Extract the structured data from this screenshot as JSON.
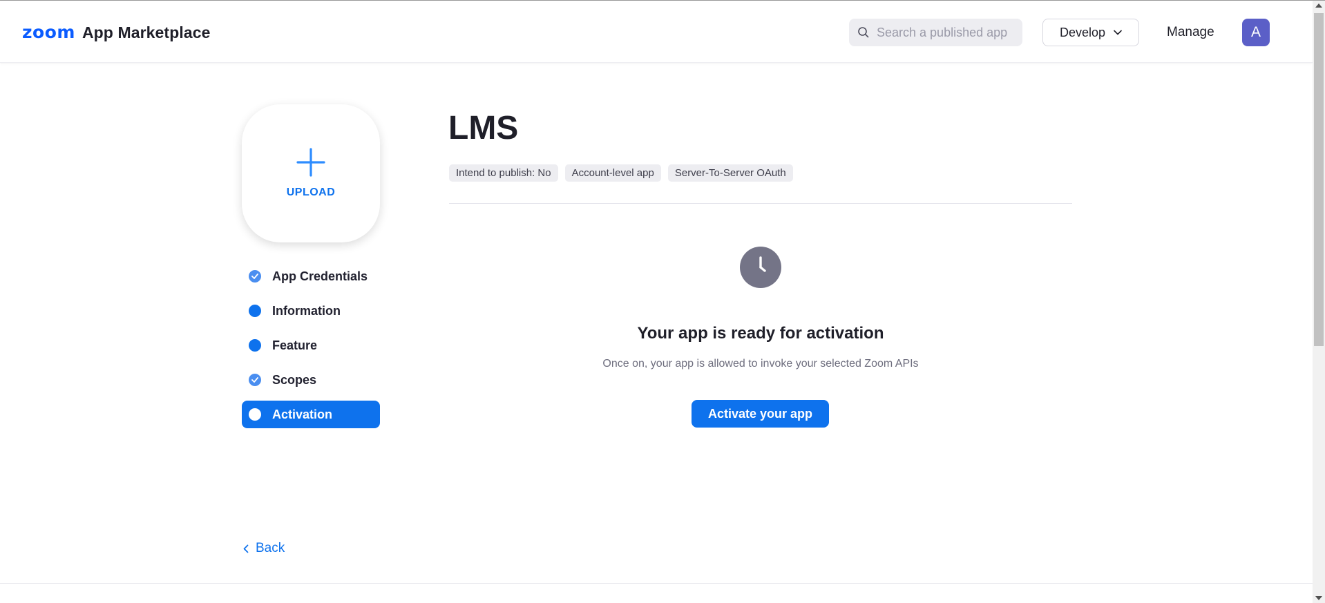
{
  "header": {
    "logo_brand": "zoom",
    "logo_text": "App Marketplace",
    "search_placeholder": "Search a published app",
    "develop_label": "Develop",
    "manage_label": "Manage",
    "avatar_initial": "A"
  },
  "sidebar": {
    "upload_label": "UPLOAD",
    "steps": [
      {
        "label": "App Credentials",
        "state": "completed"
      },
      {
        "label": "Information",
        "state": "incomplete"
      },
      {
        "label": "Feature",
        "state": "incomplete"
      },
      {
        "label": "Scopes",
        "state": "completed"
      },
      {
        "label": "Activation",
        "state": "active"
      }
    ],
    "back_label": "Back"
  },
  "main": {
    "app_name": "LMS",
    "tags": [
      "Intend to publish: No",
      "Account-level app",
      "Server-To-Server OAuth"
    ],
    "status_icon": "clock-icon",
    "ready_title": "Your app is ready for activation",
    "ready_subtitle": "Once on, your app is allowed to invoke your selected Zoom APIs",
    "activate_label": "Activate your app"
  },
  "colors": {
    "brand_blue": "#0b5cff",
    "primary": "#0e72ed",
    "avatar_bg": "#5b5fc7",
    "clock_gray": "#747487",
    "tag_bg": "#ededf1"
  }
}
